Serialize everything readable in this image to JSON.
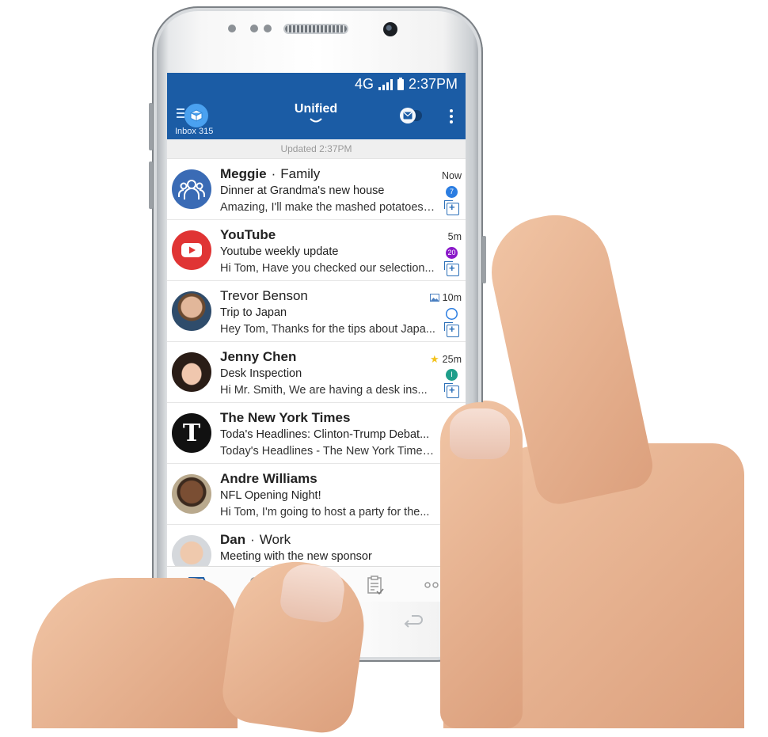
{
  "status_bar": {
    "network": "4G",
    "time": "2:37PM"
  },
  "app_bar": {
    "inbox_label": "Inbox 315",
    "title": "Unified",
    "toggle_icon": "mail-focus-toggle-icon",
    "menu_icon": "overflow-menu-icon"
  },
  "updated_text": "Updated 2:37PM",
  "emails": [
    {
      "sender": "Meggie",
      "tag": "Family",
      "subject": "Dinner at Grandma's new house",
      "preview": "Amazing, I'll make the mashed potatoes a...",
      "time": "Now",
      "badge": "7",
      "badge_color": "#2b7de1",
      "bold": true,
      "avatar": "group-avatar"
    },
    {
      "sender": "YouTube",
      "tag": "",
      "subject": "Youtube weekly update",
      "preview": "Hi Tom, Have you checked our selection...",
      "time": "5m",
      "badge": "20",
      "badge_color": "#8a18c9",
      "bold": true,
      "avatar": "youtube-avatar"
    },
    {
      "sender": "Trevor Benson",
      "tag": "",
      "subject": "Trip to Japan",
      "preview": "Hey Tom, Thanks for the tips about Japa...",
      "time": "10m",
      "badge": "",
      "badge_color": "#2b7de1",
      "bold": false,
      "avatar": "photo-avatar",
      "attachment_icon": "image-attachment-icon"
    },
    {
      "sender": "Jenny Chen",
      "tag": "",
      "subject": "Desk Inspection",
      "preview": "Hi Mr. Smith, We are having a desk ins...",
      "time": "25m",
      "badge": "I",
      "badge_color": "#1e9e8a",
      "bold": true,
      "avatar": "photo-avatar",
      "star_icon": "star-icon"
    },
    {
      "sender": "The New York Times",
      "tag": "",
      "subject": "Toda's Headlines: Clinton-Trump Debat...",
      "preview": "Today's Headlines - The New York Times Yi...",
      "time": "",
      "badge": "",
      "badge_color": "",
      "bold": true,
      "avatar": "nyt-avatar"
    },
    {
      "sender": "Andre Williams",
      "tag": "",
      "subject": "NFL Opening Night!",
      "preview": "Hi Tom, I'm going to host a party for the...",
      "time": "",
      "badge": "",
      "badge_color": "",
      "bold": true,
      "avatar": "photo-avatar"
    },
    {
      "sender": "Dan",
      "tag": "Work",
      "subject": "Meeting with the new sponsor",
      "preview": "",
      "time": "",
      "badge": "",
      "badge_color": "#1e9e8a",
      "bold": true,
      "avatar": "photo-avatar"
    }
  ],
  "tabs": [
    {
      "icon": "inbox-tab-icon",
      "active": true
    },
    {
      "icon": "people-tab-icon",
      "active": false
    },
    {
      "icon": "tasks-tab-icon",
      "active": false
    },
    {
      "icon": "more-tab-icon",
      "active": false
    }
  ],
  "colors": {
    "primary": "#1b5ca5",
    "accent": "#4aa1f0",
    "unread_blue": "#2b7de1",
    "purple": "#8a18c9",
    "teal": "#1e9e8a",
    "youtube_red": "#e03434"
  }
}
